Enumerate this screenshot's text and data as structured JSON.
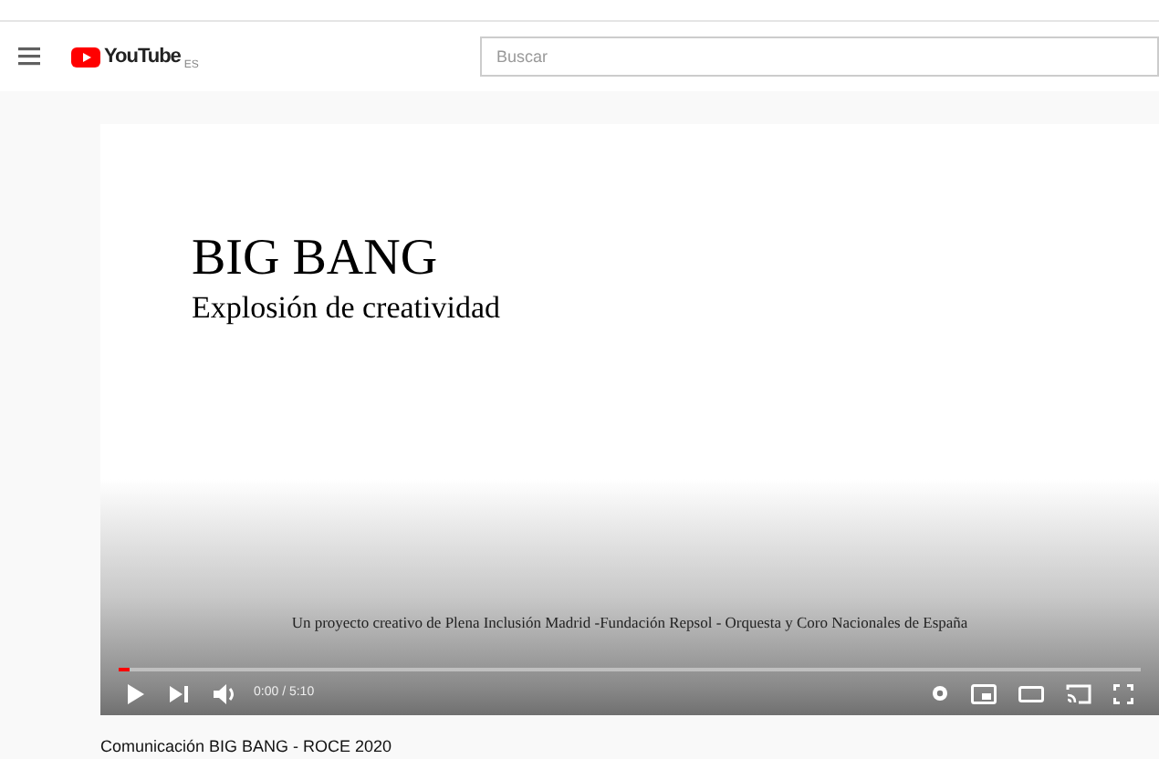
{
  "header": {
    "logo_text": "YouTube",
    "logo_region": "ES",
    "search": {
      "placeholder": "Buscar"
    }
  },
  "player": {
    "slide": {
      "title": "BIG BANG",
      "subtitle": "Explosión de creatividad",
      "credit": "Un proyecto creativo de Plena Inclusión Madrid -Fundación Repsol - Orquesta  y Coro Nacionales de España"
    },
    "progress": {
      "level": 0.01
    },
    "time": "0:00 / 5:10"
  },
  "video_title": "Comunicación BIG BANG - ROCE 2020"
}
